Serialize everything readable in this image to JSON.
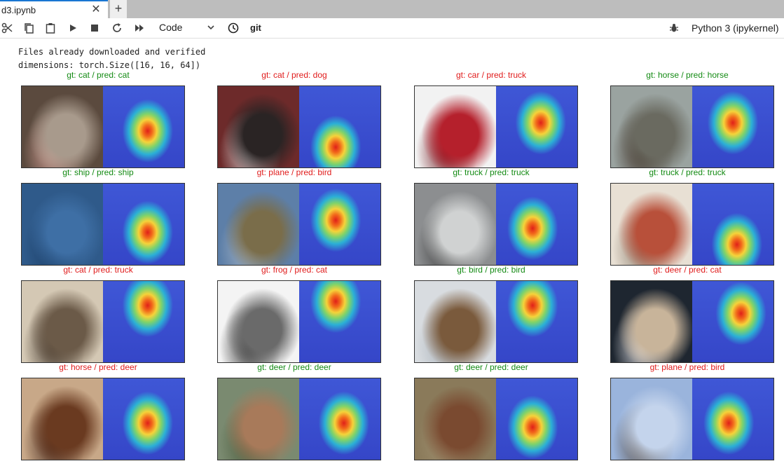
{
  "tab": {
    "label": "d3.ipynb",
    "close_glyph": "✕",
    "add_glyph": "+"
  },
  "toolbar": {
    "cell_type": "Code",
    "git_label": "git",
    "kernel": "Python 3 (ipykernel)"
  },
  "output": {
    "line1": "Files already downloaded and verified",
    "line2": "dimensions: torch.Size([16, 16, 64])"
  },
  "colors": {
    "correct": "#138a13",
    "incorrect": "#e01b1b",
    "tab_accent": "#1976d2"
  },
  "panels": [
    {
      "title": "gt: cat / pred: cat",
      "correct": true,
      "orig": [
        "#5b4a3e",
        "#a89a8c",
        "#d9a39a"
      ],
      "heat": [
        [
          0.55,
          0.55,
          0.9
        ]
      ]
    },
    {
      "title": "gt: cat / pred: dog",
      "correct": false,
      "orig": [
        "#6d2a2a",
        "#2a2424",
        "#d8d8d8"
      ],
      "heat": [
        [
          0.45,
          0.75,
          0.8
        ]
      ]
    },
    {
      "title": "gt: car / pred: truck",
      "correct": false,
      "orig": [
        "#f2f2f2",
        "#b5202c",
        "#6e1119"
      ],
      "heat": [
        [
          0.55,
          0.45,
          0.7
        ]
      ]
    },
    {
      "title": "gt: horse / pred: horse",
      "correct": true,
      "orig": [
        "#9aa3a0",
        "#6a6a60",
        "#3c2c22"
      ],
      "heat": [
        [
          0.5,
          0.45,
          0.9
        ]
      ]
    },
    {
      "title": "gt: ship / pred: ship",
      "correct": true,
      "orig": [
        "#2f5a8a",
        "#3e6fa5",
        "#1c3f68"
      ],
      "heat": [
        [
          0.55,
          0.6,
          0.85
        ]
      ]
    },
    {
      "title": "gt: plane / pred: bird",
      "correct": false,
      "orig": [
        "#5d7fa8",
        "#7a6d4a",
        "#a9b6c4"
      ],
      "heat": [
        [
          0.45,
          0.45,
          0.85
        ]
      ]
    },
    {
      "title": "gt: truck / pred: truck",
      "correct": true,
      "orig": [
        "#8c8e90",
        "#d0d2d2",
        "#3c3c3c"
      ],
      "heat": [
        [
          0.45,
          0.55,
          0.85
        ]
      ]
    },
    {
      "title": "gt: truck / pred: truck",
      "correct": true,
      "orig": [
        "#e8e0d4",
        "#b8503a",
        "#8a7a6a"
      ],
      "heat": [
        [
          0.55,
          0.75,
          0.85
        ]
      ]
    },
    {
      "title": "gt: cat / pred: truck",
      "correct": false,
      "orig": [
        "#d4c8b4",
        "#6b5a48",
        "#3a2e24"
      ],
      "heat": [
        [
          0.55,
          0.3,
          0.75
        ]
      ]
    },
    {
      "title": "gt: frog / pred: cat",
      "correct": false,
      "orig": [
        "#f4f4f4",
        "#6a6a6a",
        "#262626"
      ],
      "heat": [
        [
          0.45,
          0.25,
          0.8
        ]
      ]
    },
    {
      "title": "gt: bird / pred: bird",
      "correct": true,
      "orig": [
        "#d8dce0",
        "#7a5a3c",
        "#a8b0b8"
      ],
      "heat": [
        [
          0.45,
          0.3,
          0.85
        ]
      ]
    },
    {
      "title": "gt: deer / pred: cat",
      "correct": false,
      "orig": [
        "#1e2630",
        "#c8b49a",
        "#e8e8ec"
      ],
      "heat": [
        [
          0.6,
          0.4,
          0.85
        ]
      ]
    },
    {
      "title": "gt: horse / pred: deer",
      "correct": false,
      "orig": [
        "#c8a888",
        "#6a3a20",
        "#402218"
      ],
      "heat": [
        [
          0.55,
          0.55,
          0.9
        ]
      ]
    },
    {
      "title": "gt: deer / pred: deer",
      "correct": true,
      "orig": [
        "#7a8a70",
        "#a87a5a",
        "#4a5a3a"
      ],
      "heat": [
        [
          0.55,
          0.55,
          0.85
        ]
      ]
    },
    {
      "title": "gt: deer / pred: deer",
      "correct": true,
      "orig": [
        "#8a7a5a",
        "#7a4a30",
        "#a09070"
      ],
      "heat": [
        [
          0.45,
          0.6,
          0.85
        ]
      ]
    },
    {
      "title": "gt: plane / pred: bird",
      "correct": false,
      "orig": [
        "#9ab4dc",
        "#c4d4ec",
        "#5a4a3a"
      ],
      "heat": [
        [
          0.45,
          0.55,
          0.6
        ]
      ]
    }
  ]
}
